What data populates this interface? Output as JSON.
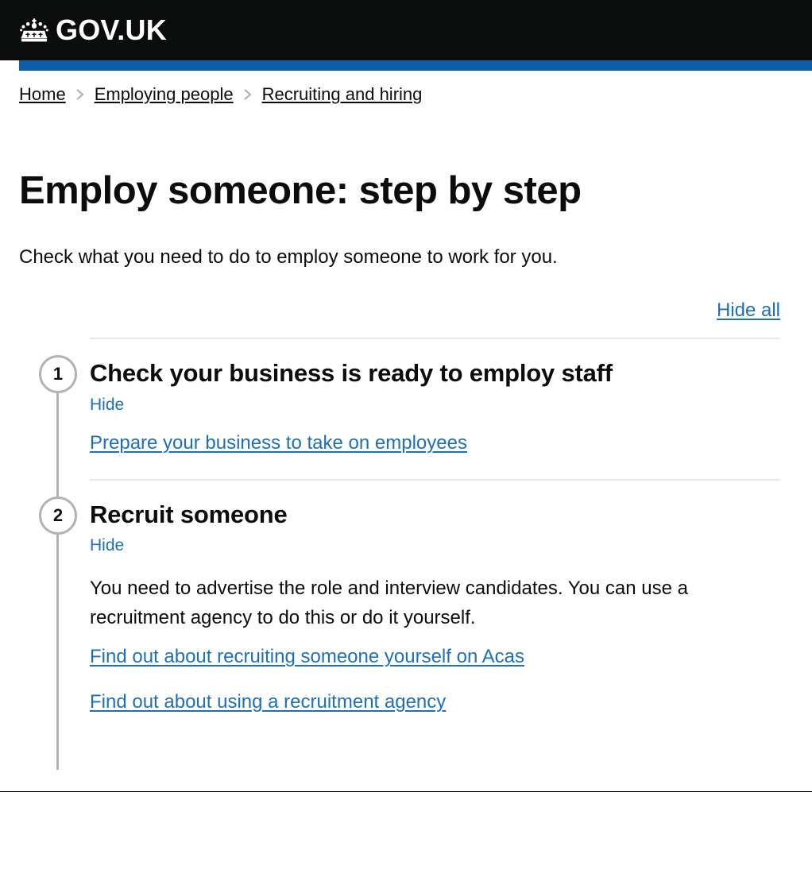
{
  "header": {
    "logo_icon": "gov-uk-crown-icon",
    "logo_text": "GOV.UK",
    "accent_color": "#0b5da5",
    "background_color": "#0b0c0c"
  },
  "breadcrumbs": {
    "separator_icon": "chevron-right-icon",
    "items": [
      {
        "label": "Home"
      },
      {
        "label": "Employing people"
      },
      {
        "label": "Recruiting and hiring"
      }
    ]
  },
  "main": {
    "title": "Employ someone: step by step",
    "lede": "Check what you need to do to employ someone to work for you.",
    "hide_all_label": "Hide all",
    "link_color": "#1d70b8"
  },
  "steps": [
    {
      "number": "1",
      "title": "Check your business is ready to employ staff",
      "toggle_label": "Hide",
      "paragraphs": [],
      "links": [
        {
          "label": "Prepare your business to take on employees"
        }
      ]
    },
    {
      "number": "2",
      "title": "Recruit someone",
      "toggle_label": "Hide",
      "paragraphs": [
        "You need to advertise the role and interview candidates. You can use a recruitment agency to do this or do it yourself."
      ],
      "links": [
        {
          "label": "Find out about recruiting someone yourself on Acas"
        },
        {
          "label": "Find out about using a recruitment agency"
        }
      ]
    }
  ]
}
